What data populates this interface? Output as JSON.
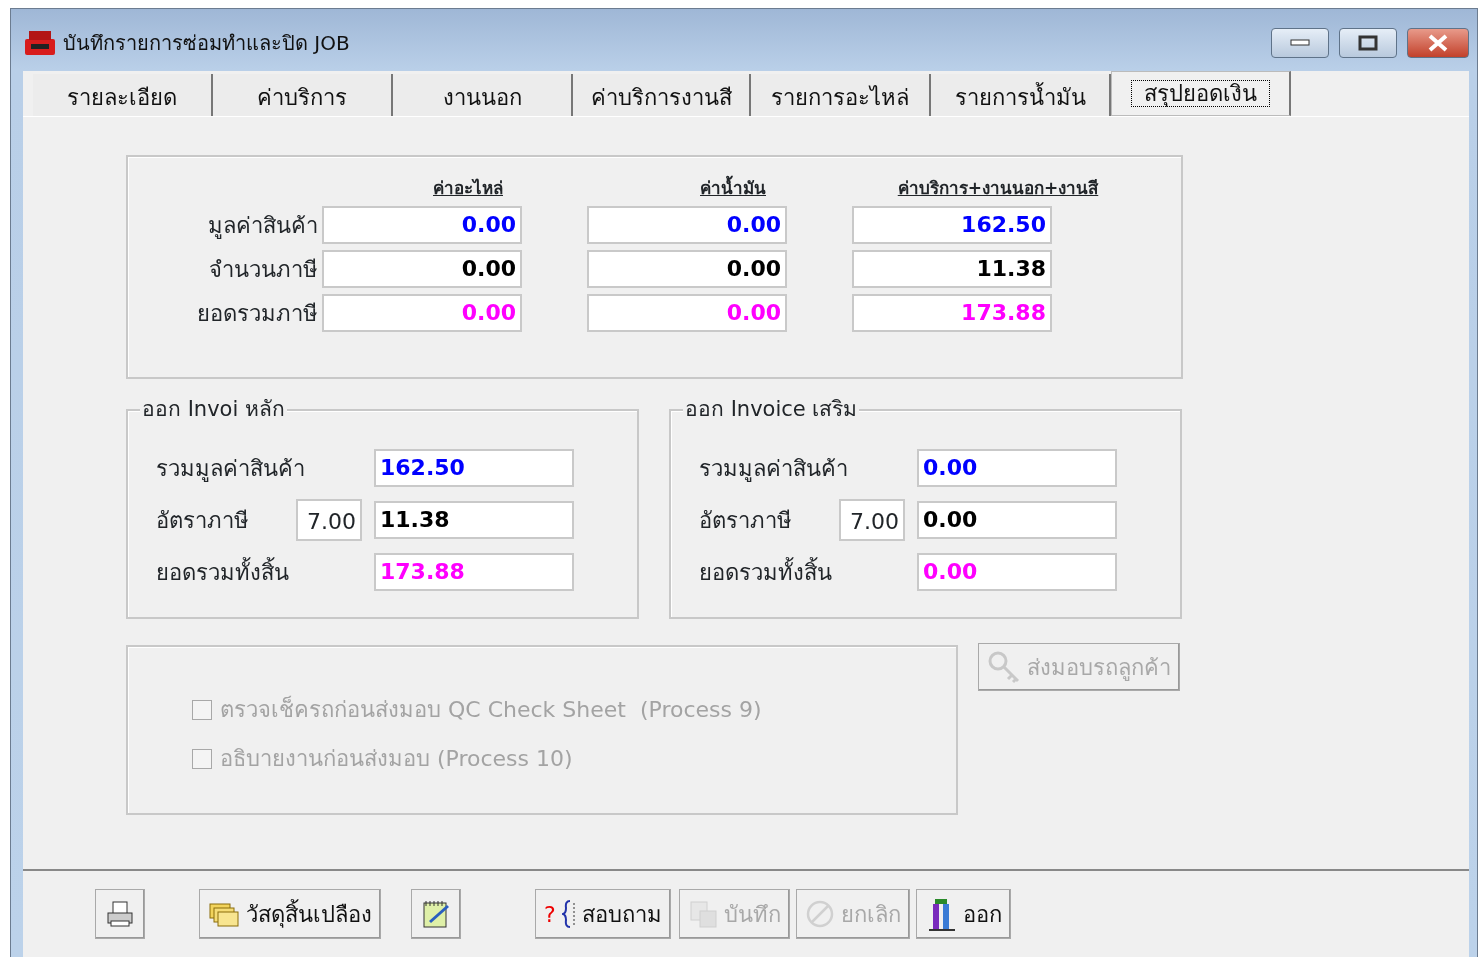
{
  "window": {
    "title": "บันทึกรายการซ่อมทำและปิด JOB"
  },
  "tabs": [
    {
      "label": "รายละเอียด",
      "selected": false
    },
    {
      "label": "ค่าบริการ",
      "selected": false
    },
    {
      "label": "งานนอก",
      "selected": false
    },
    {
      "label": "ค่าบริการงานสี",
      "selected": false
    },
    {
      "label": "รายการอะไหล่",
      "selected": false
    },
    {
      "label": "รายการน้ำมัน",
      "selected": false
    },
    {
      "label": "สรุปยอดเงิน",
      "selected": true
    }
  ],
  "summary": {
    "columns": [
      "ค่าอะไหล่",
      "ค่าน้ำมัน",
      "ค่าบริการ+งานนอก+งานสี"
    ],
    "rows": [
      {
        "label": "มูลค่าสินค้า",
        "kind": "value",
        "values": [
          "0.00",
          "0.00",
          "162.50"
        ]
      },
      {
        "label": "จำนวนภาษี",
        "kind": "tax",
        "values": [
          "0.00",
          "0.00",
          "11.38"
        ]
      },
      {
        "label": "ยอดรวมภาษี",
        "kind": "total",
        "values": [
          "0.00",
          "0.00",
          "173.88"
        ]
      }
    ]
  },
  "invoices": [
    {
      "title": "ออก Invoi หลัก",
      "rows": [
        {
          "label": "รวมมูลค่าสินค้า",
          "kind": "value",
          "value": "162.50"
        },
        {
          "label": "อัตราภาษี",
          "kind": "tax",
          "rate": "7.00",
          "value": "11.38"
        },
        {
          "label": "ยอดรวมทั้งสิ้น",
          "kind": "total",
          "value": "173.88"
        }
      ]
    },
    {
      "title": "ออก Invoice เสริม",
      "rows": [
        {
          "label": "รวมมูลค่าสินค้า",
          "kind": "value",
          "value": "0.00"
        },
        {
          "label": "อัตราภาษี",
          "kind": "tax",
          "rate": "7.00",
          "value": "0.00"
        },
        {
          "label": "ยอดรวมทั้งสิ้น",
          "kind": "total",
          "value": "0.00"
        }
      ]
    }
  ],
  "checks": [
    {
      "label": "ตรวจเช็ครถก่อนส่งมอบ QC Check Sheet  (Process 9)",
      "checked": false,
      "disabled": true
    },
    {
      "label": "อธิบายงานก่อนส่งมอบ (Process 10)",
      "checked": false,
      "disabled": true
    }
  ],
  "deliver_button": {
    "label": "ส่งมอบรถลูกค้า",
    "disabled": true
  },
  "toolbar": [
    {
      "kind": "print",
      "disabled": false
    },
    {
      "kind": "materials",
      "label": "วัสดุสิ้นเปลือง",
      "disabled": false
    },
    {
      "kind": "note",
      "disabled": false
    },
    {
      "kind": "query",
      "icon_text": "?",
      "label": "สอบถาม",
      "disabled": false
    },
    {
      "kind": "save",
      "label": "บันทึก",
      "disabled": true
    },
    {
      "kind": "cancel",
      "label": "ยกเลิก",
      "disabled": true
    },
    {
      "kind": "exit",
      "label": "ออก",
      "disabled": false
    }
  ]
}
